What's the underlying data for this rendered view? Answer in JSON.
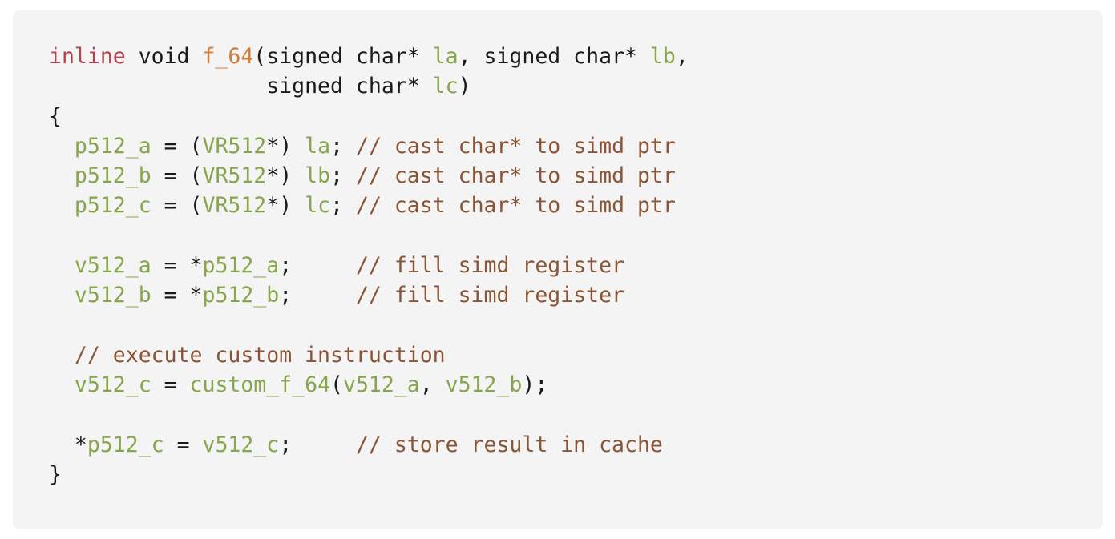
{
  "colors": {
    "keyword": "#b5434f",
    "function": "#d27d3a",
    "identifier": "#86a54d",
    "comment": "#8a5436",
    "text": "#1a1a1a",
    "background": "#f4f4f4"
  },
  "code": {
    "language": "c",
    "lines": [
      [
        {
          "t": "inline",
          "k": "keyword"
        },
        {
          "t": " void ",
          "k": "type"
        },
        {
          "t": "f_64",
          "k": "func"
        },
        {
          "t": "(signed char* ",
          "k": "punct"
        },
        {
          "t": "la",
          "k": "ident"
        },
        {
          "t": ", signed char* ",
          "k": "punct"
        },
        {
          "t": "lb",
          "k": "ident"
        },
        {
          "t": ",",
          "k": "punct"
        }
      ],
      [
        {
          "t": "                 signed char* ",
          "k": "punct"
        },
        {
          "t": "lc",
          "k": "ident"
        },
        {
          "t": ")",
          "k": "punct"
        }
      ],
      [
        {
          "t": "{",
          "k": "punct"
        }
      ],
      [
        {
          "t": "  ",
          "k": "space"
        },
        {
          "t": "p512_a",
          "k": "ident"
        },
        {
          "t": " = (",
          "k": "punct"
        },
        {
          "t": "VR512",
          "k": "ident"
        },
        {
          "t": "*) ",
          "k": "punct"
        },
        {
          "t": "la",
          "k": "ident"
        },
        {
          "t": "; ",
          "k": "punct"
        },
        {
          "t": "// cast char* to simd ptr",
          "k": "comment"
        }
      ],
      [
        {
          "t": "  ",
          "k": "space"
        },
        {
          "t": "p512_b",
          "k": "ident"
        },
        {
          "t": " = (",
          "k": "punct"
        },
        {
          "t": "VR512",
          "k": "ident"
        },
        {
          "t": "*) ",
          "k": "punct"
        },
        {
          "t": "lb",
          "k": "ident"
        },
        {
          "t": "; ",
          "k": "punct"
        },
        {
          "t": "// cast char* to simd ptr",
          "k": "comment"
        }
      ],
      [
        {
          "t": "  ",
          "k": "space"
        },
        {
          "t": "p512_c",
          "k": "ident"
        },
        {
          "t": " = (",
          "k": "punct"
        },
        {
          "t": "VR512",
          "k": "ident"
        },
        {
          "t": "*) ",
          "k": "punct"
        },
        {
          "t": "lc",
          "k": "ident"
        },
        {
          "t": "; ",
          "k": "punct"
        },
        {
          "t": "// cast char* to simd ptr",
          "k": "comment"
        }
      ],
      [],
      [
        {
          "t": "  ",
          "k": "space"
        },
        {
          "t": "v512_a",
          "k": "ident"
        },
        {
          "t": " = *",
          "k": "punct"
        },
        {
          "t": "p512_a",
          "k": "ident"
        },
        {
          "t": ";     ",
          "k": "punct"
        },
        {
          "t": "// fill simd register",
          "k": "comment"
        }
      ],
      [
        {
          "t": "  ",
          "k": "space"
        },
        {
          "t": "v512_b",
          "k": "ident"
        },
        {
          "t": " = *",
          "k": "punct"
        },
        {
          "t": "p512_b",
          "k": "ident"
        },
        {
          "t": ";     ",
          "k": "punct"
        },
        {
          "t": "// fill simd register",
          "k": "comment"
        }
      ],
      [],
      [
        {
          "t": "  ",
          "k": "space"
        },
        {
          "t": "// execute custom instruction",
          "k": "comment"
        }
      ],
      [
        {
          "t": "  ",
          "k": "space"
        },
        {
          "t": "v512_c",
          "k": "ident"
        },
        {
          "t": " = ",
          "k": "punct"
        },
        {
          "t": "custom_f_64",
          "k": "ident"
        },
        {
          "t": "(",
          "k": "punct"
        },
        {
          "t": "v512_a",
          "k": "ident"
        },
        {
          "t": ", ",
          "k": "punct"
        },
        {
          "t": "v512_b",
          "k": "ident"
        },
        {
          "t": ");",
          "k": "punct"
        }
      ],
      [],
      [
        {
          "t": "  *",
          "k": "punct"
        },
        {
          "t": "p512_c",
          "k": "ident"
        },
        {
          "t": " = ",
          "k": "punct"
        },
        {
          "t": "v512_c",
          "k": "ident"
        },
        {
          "t": ";     ",
          "k": "punct"
        },
        {
          "t": "// store result in cache",
          "k": "comment"
        }
      ],
      [
        {
          "t": "}",
          "k": "punct"
        }
      ]
    ]
  }
}
